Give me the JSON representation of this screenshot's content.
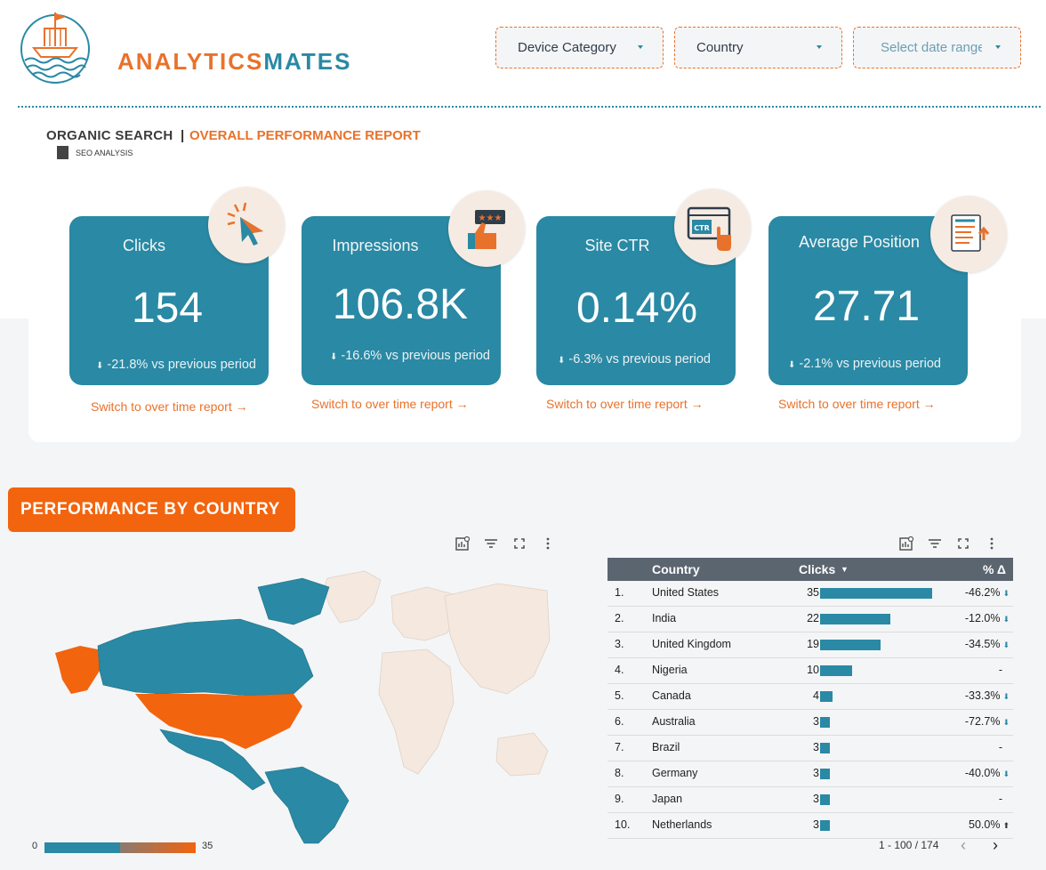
{
  "logo": {
    "part1": "ANALYTICS",
    "part2": "MATES"
  },
  "filters": [
    {
      "label": "Device Category"
    },
    {
      "label": "Country"
    },
    {
      "label": "Select date range"
    }
  ],
  "header": {
    "section": "ORGANIC SEARCH",
    "separator": "|",
    "title": "OVERALL PERFORMANCE REPORT",
    "tag": "SEO ANALYSIS"
  },
  "kpis": [
    {
      "label": "Clicks",
      "value": "154",
      "delta": "-21.8% vs previous period",
      "icon": "cursor-click-icon",
      "link": "Switch to over time report →"
    },
    {
      "label": "Impressions",
      "value": "106.8K",
      "delta": "-16.6% vs previous period",
      "icon": "thumbs-up-rating-icon",
      "link": "Switch to over time report →"
    },
    {
      "label": "Site CTR",
      "value": "0.14%",
      "delta": "-6.3% vs previous period",
      "icon": "ctr-click-icon",
      "link": "Switch to over time report →"
    },
    {
      "label": "Average Position",
      "value": "27.71",
      "delta": "-2.1% vs previous period",
      "icon": "ranking-list-icon",
      "link": "Switch to over time report →"
    }
  ],
  "delta_arrow": "⬇",
  "country_section": {
    "title": "PERFORMANCE BY COUNTRY"
  },
  "map": {
    "legend_min": "0",
    "legend_max": "35",
    "color_low": "#2a89a4",
    "color_high": "#f2640e"
  },
  "table": {
    "headers": {
      "country": "Country",
      "clicks": "Clicks",
      "sort": "▼",
      "pct": "% Δ"
    },
    "rows": [
      {
        "rank": "1.",
        "country": "United States",
        "clicks": 35,
        "pct": "-46.2%",
        "dir": "down"
      },
      {
        "rank": "2.",
        "country": "India",
        "clicks": 22,
        "pct": "-12.0%",
        "dir": "down"
      },
      {
        "rank": "3.",
        "country": "United Kingdom",
        "clicks": 19,
        "pct": "-34.5%",
        "dir": "down"
      },
      {
        "rank": "4.",
        "country": "Nigeria",
        "clicks": 10,
        "pct": "-",
        "dir": "none"
      },
      {
        "rank": "5.",
        "country": "Canada",
        "clicks": 4,
        "pct": "-33.3%",
        "dir": "down"
      },
      {
        "rank": "6.",
        "country": "Australia",
        "clicks": 3,
        "pct": "-72.7%",
        "dir": "down"
      },
      {
        "rank": "7.",
        "country": "Brazil",
        "clicks": 3,
        "pct": "-",
        "dir": "none"
      },
      {
        "rank": "8.",
        "country": "Germany",
        "clicks": 3,
        "pct": "-40.0%",
        "dir": "down"
      },
      {
        "rank": "9.",
        "country": "Japan",
        "clicks": 3,
        "pct": "-",
        "dir": "none"
      },
      {
        "rank": "10.",
        "country": "Netherlands",
        "clicks": 3,
        "pct": "50.0%",
        "dir": "up"
      }
    ],
    "max_clicks": 35,
    "pagination": "1 - 100 / 174",
    "prev": "‹",
    "next": "›"
  },
  "colors": {
    "accent": "#e8722b",
    "primary": "#2a89a4",
    "banner": "#f2640e"
  }
}
